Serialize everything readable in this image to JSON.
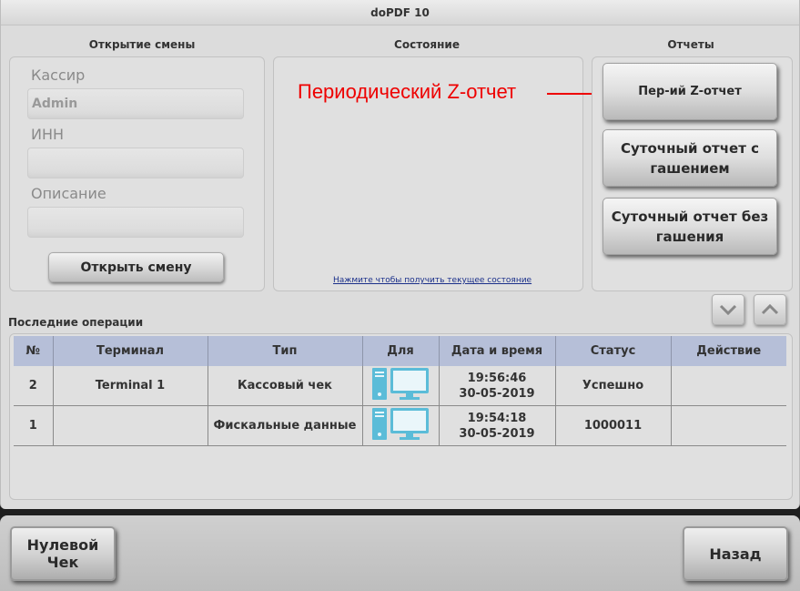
{
  "window": {
    "title": "doPDF 10"
  },
  "shift": {
    "title": "Открытие смены",
    "cashier_label": "Кассир",
    "cashier_value": "Admin",
    "inn_label": "ИНН",
    "inn_value": "",
    "description_label": "Описание",
    "description_value": "",
    "open_button": "Открыть смену"
  },
  "state": {
    "title": "Состояние",
    "link": "Нажмите чтобы получить текущее состояние"
  },
  "annotation": {
    "text": "Периодический Z-отчет",
    "color": "#ee0000"
  },
  "reports": {
    "title": "Отчеты",
    "buttons": [
      {
        "label": "Пер-ий Z-отчет"
      },
      {
        "label": "Суточный отчет с гашением"
      },
      {
        "label": "Суточный отчет без гашения"
      }
    ]
  },
  "operations": {
    "title": "Последние операции",
    "columns": [
      "№",
      "Терминал",
      "Тип",
      "Для",
      "Дата и время",
      "Статус",
      "Действие"
    ],
    "rows": [
      {
        "num": "2",
        "terminal": "Terminal 1",
        "type": "Кассовый чек",
        "for_icon": "computer-monitor-icon",
        "time": "19:56:46",
        "date": "30-05-2019",
        "status": "Успешно",
        "action": ""
      },
      {
        "num": "1",
        "terminal": "",
        "type": "Фискальные данные",
        "for_icon": "computer-monitor-icon",
        "time": "19:54:18",
        "date": "30-05-2019",
        "status": "1000011",
        "action": ""
      }
    ],
    "header_color": "#b6bfd8",
    "icon_color": "#5bbcd8"
  },
  "footer": {
    "zero_check": "Нулевой Чек",
    "back": "Назад"
  }
}
